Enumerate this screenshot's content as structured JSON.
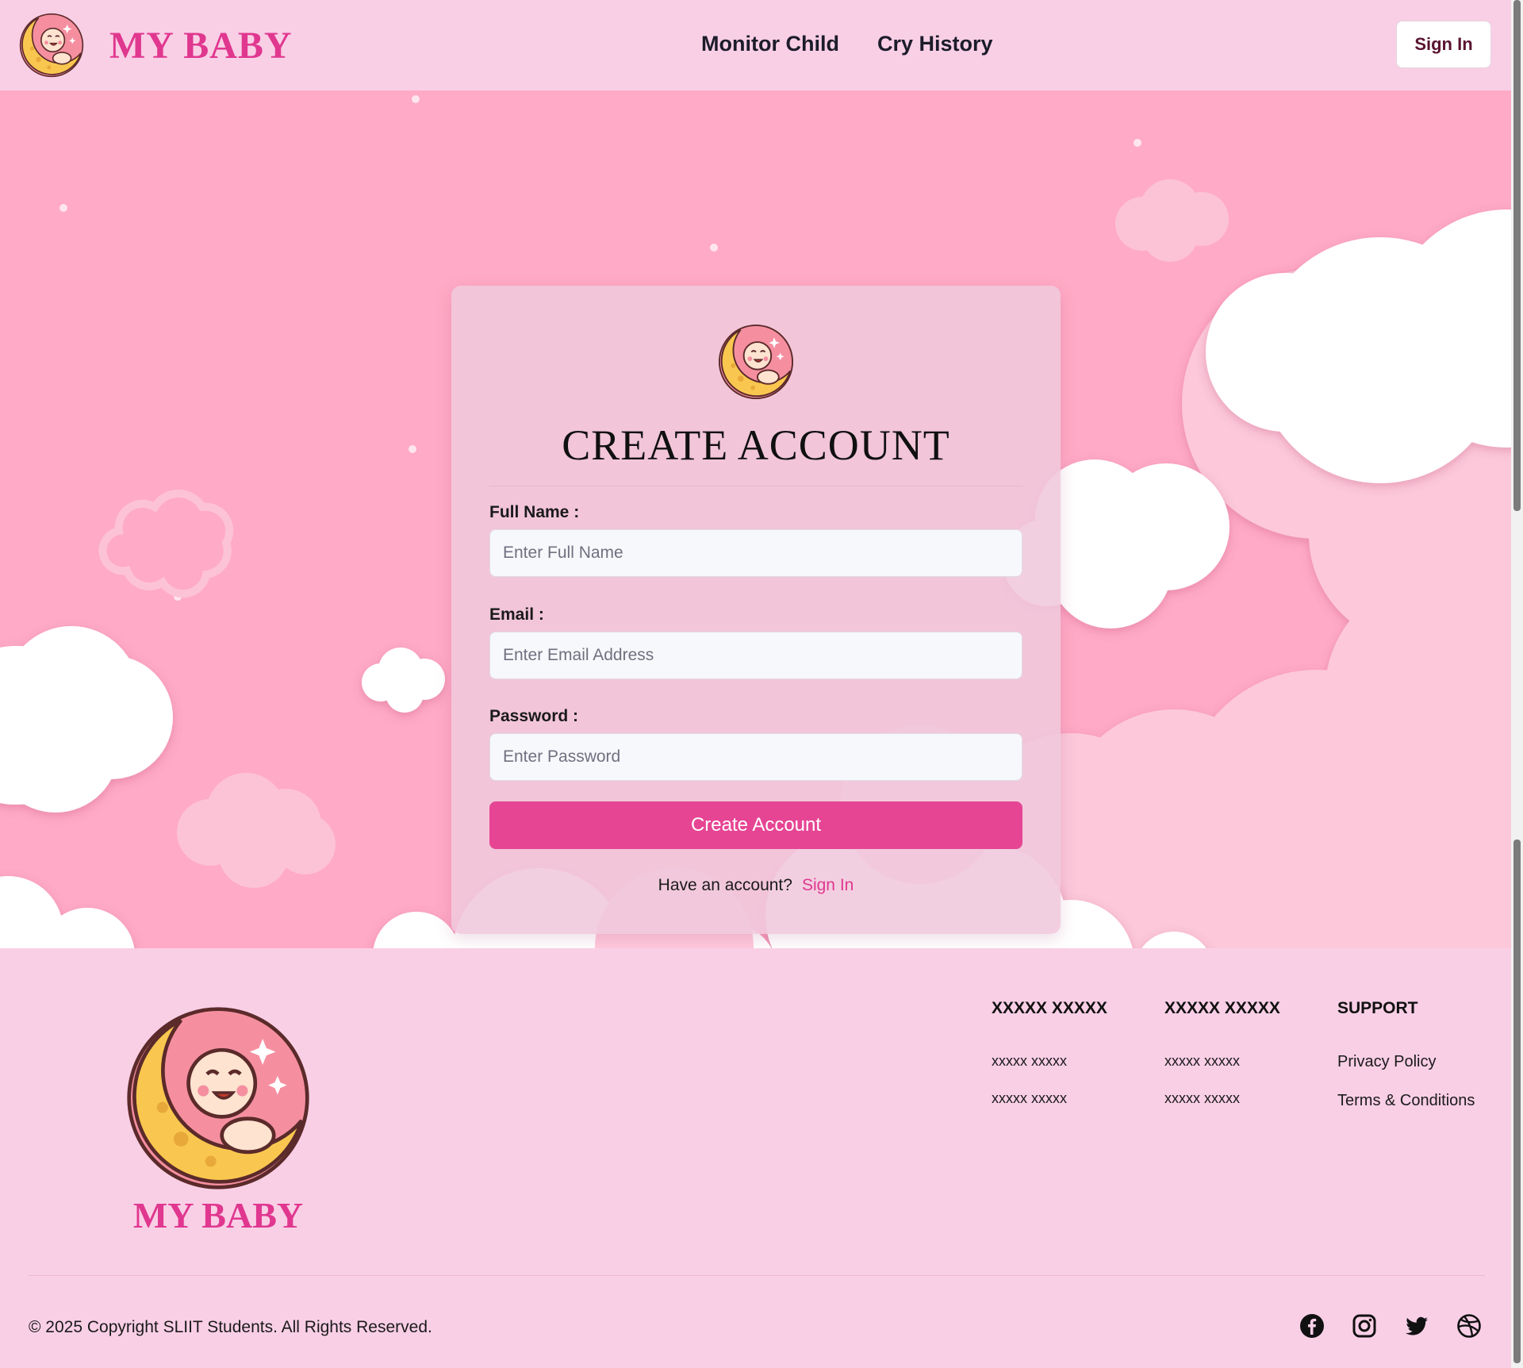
{
  "header": {
    "brand": "MY BABY",
    "nav": [
      "Monitor Child",
      "Cry History"
    ],
    "signin_label": "Sign In"
  },
  "card": {
    "title": "CREATE ACCOUNT",
    "fields": [
      {
        "label": "Full Name :",
        "placeholder": "Enter Full Name",
        "value": ""
      },
      {
        "label": "Email :",
        "placeholder": "Enter Email Address",
        "value": ""
      },
      {
        "label": "Password :",
        "placeholder": "Enter Password",
        "value": ""
      }
    ],
    "submit_label": "Create Account",
    "have_account_text": "Have an account?",
    "signin_link": "Sign In"
  },
  "footer": {
    "brand": "MY BABY",
    "columns": [
      {
        "heading": "XXXXX XXXXX",
        "links": [
          "xxxxx xxxxx",
          "xxxxx xxxxx"
        ]
      },
      {
        "heading": "XXXXX XXXXX",
        "links": [
          "xxxxx xxxxx",
          "xxxxx xxxxx"
        ]
      },
      {
        "heading": "SUPPORT",
        "links": [
          "Privacy Policy",
          "Terms & Conditions"
        ]
      }
    ],
    "copyright": "© 2025 Copyright SLIIT Students. All Rights Reserved.",
    "socials": [
      "facebook-icon",
      "instagram-icon",
      "twitter-icon",
      "dribbble-icon"
    ]
  },
  "colors": {
    "brand_pink": "#e0378f",
    "button_pink": "#e64594",
    "header_bg": "#f9cfe6",
    "hero_bg": "#ffaac6"
  }
}
